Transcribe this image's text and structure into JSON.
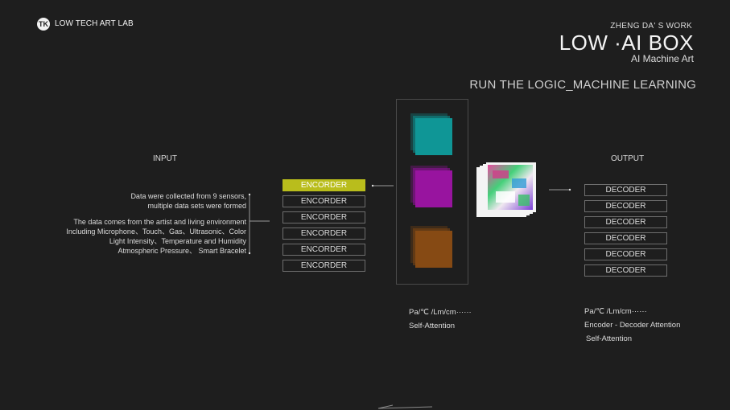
{
  "header": {
    "logo_mark": "TK",
    "logo_text": "LOW TECH ART LAB",
    "work_label": "ZHENG DA' S WORK",
    "title": "LOW ·AI BOX",
    "subtitle": "AI Machine Art",
    "run_title": "RUN THE LOGIC_MACHINE LEARNING"
  },
  "input": {
    "label": "INPUT",
    "note1_line1": "Data were collected from 9 sensors,",
    "note1_line2": "multiple data sets were formed",
    "note2_line1": "The data comes from the artist and  living environment",
    "note2_line2": "Including Microphone、Touch、Gas、Ultrasonic、Color",
    "note2_line3": "Light Intensity、Temperature and Humidity",
    "note2_line4": "Atmospheric Pressure、 Smart Bracelet"
  },
  "encoders": [
    "ENCORDER",
    "ENCORDER",
    "ENCORDER",
    "ENCORDER",
    "ENCORDER",
    "ENCORDER"
  ],
  "middle": {
    "units": "Pa/℃ /Lm/cm······",
    "attention": "Self-Attention",
    "stack_colors": [
      "#0e8a8a",
      "#8c1396",
      "#7b4412"
    ]
  },
  "output": {
    "label": "OUTPUT",
    "decoders": [
      "DECODER",
      "DECODER",
      "DECODER",
      "DECODER",
      "DECODER",
      "DECODER"
    ],
    "units": "Pa/℃ /Lm/cm······",
    "attention1": "Encoder - Decoder Attention",
    "attention2": "Self-Attention"
  },
  "colors": {
    "background": "#1e1e1e",
    "encoder_active": "#b9bd1c"
  }
}
